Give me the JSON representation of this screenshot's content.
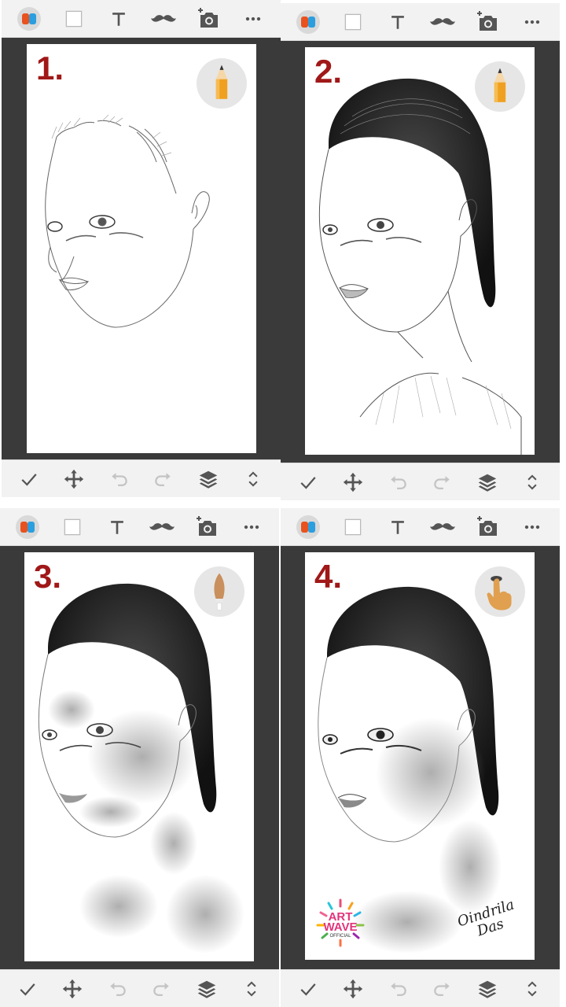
{
  "panels": [
    {
      "step": "1.",
      "tool": "pencil-icon"
    },
    {
      "step": "2.",
      "tool": "pencil-icon"
    },
    {
      "step": "3.",
      "tool": "brush-icon"
    },
    {
      "step": "4.",
      "tool": "smudge-finger-icon"
    }
  ],
  "logo": {
    "line1": "ART",
    "line2": "WAVE",
    "line3": "OFFICIAL"
  },
  "signature": {
    "line1": "Oindrila",
    "line2": "Das"
  },
  "colors": {
    "step_number": "#a01818",
    "toolbar_bg": "#f2f2f2",
    "frame_bg": "#3a3a3a",
    "pencil": "#f0a020",
    "skin": "#d9a066"
  }
}
